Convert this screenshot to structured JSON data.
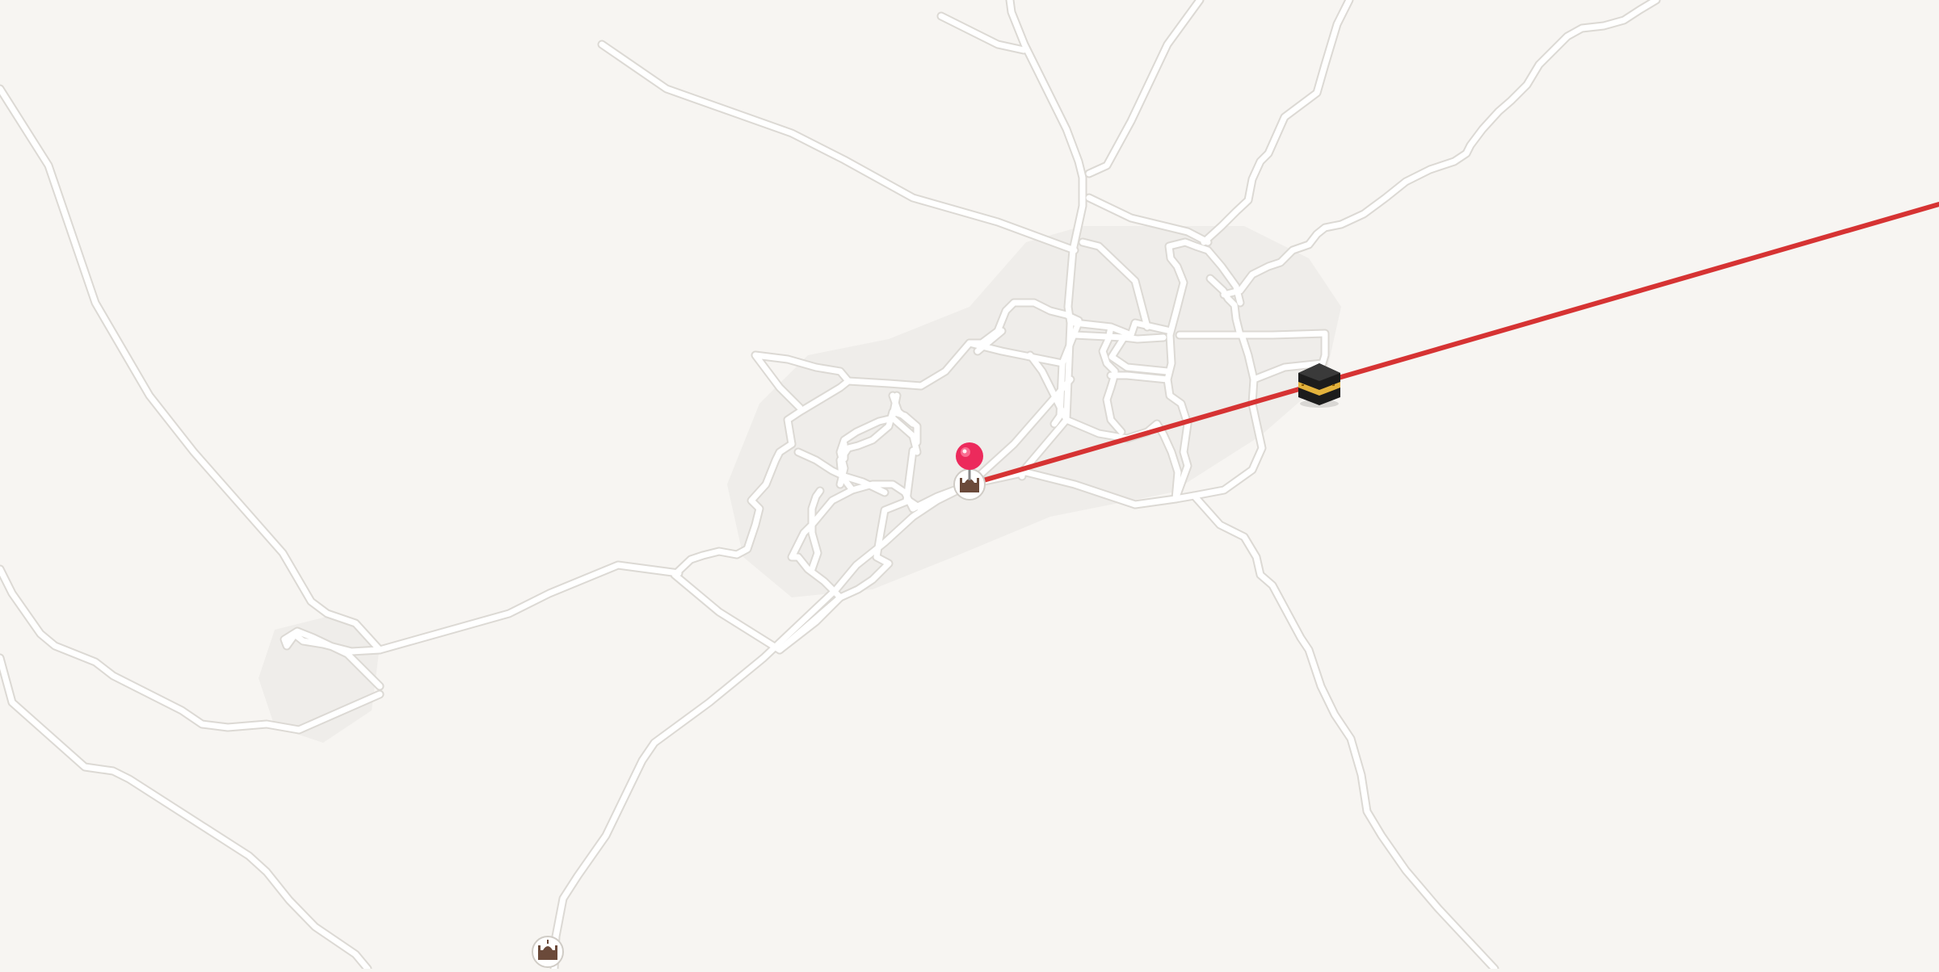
{
  "map": {
    "background_color": "#f7f5f2",
    "road_color": "#ffffff",
    "road_casing_color": "#dcd9d4",
    "built_area_color": "#efedea"
  },
  "qibla": {
    "line_color": "#d63333",
    "kaaba_icon": "kaaba-icon"
  },
  "location_pin": {
    "icon": "location-pin-icon",
    "color": "#ec2a5c"
  },
  "pois": [
    {
      "icon": "mosque-icon"
    },
    {
      "icon": "mosque-icon"
    }
  ]
}
